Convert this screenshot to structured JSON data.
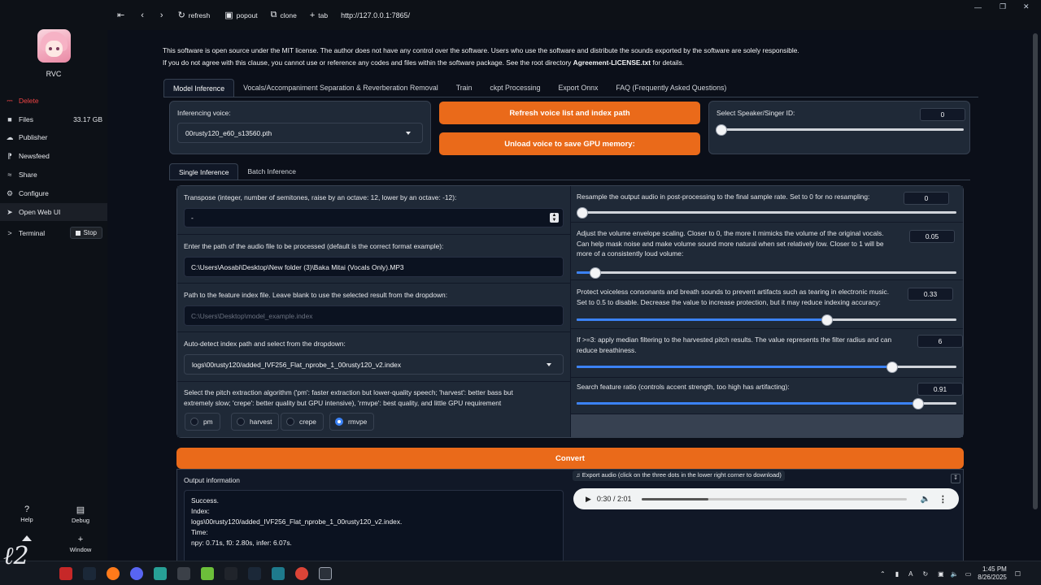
{
  "sidebar": {
    "app_name": "RVC",
    "items": [
      {
        "label": "Delete",
        "icon": "trash-icon"
      },
      {
        "label": "Files",
        "icon": "folder-icon",
        "value": "33.17 GB"
      },
      {
        "label": "Publisher",
        "icon": "publish-icon"
      },
      {
        "label": "Newsfeed",
        "icon": "rss-icon"
      },
      {
        "label": "Share",
        "icon": "wifi-icon"
      },
      {
        "label": "Configure",
        "icon": "gear-icon"
      },
      {
        "label": "Open Web UI",
        "icon": "rocket-icon"
      },
      {
        "label": "Terminal",
        "icon": "terminal-icon"
      }
    ],
    "stop_label": "Stop",
    "help_label": "Help",
    "debug_label": "Debug",
    "window_label": "Window"
  },
  "browser": {
    "refresh_label": "refresh",
    "popout_label": "popout",
    "clone_label": "clone",
    "tab_label": "tab",
    "url": "http://127.0.0.1:7865/"
  },
  "notice": {
    "line1": "This software is open source under the MIT license. The author does not have any control over the software. Users who use the software and distribute the sounds exported by the software are solely responsible.",
    "line2_pre": "If you do not agree with this clause, you cannot use or reference any codes and files within the software package. See the root directory ",
    "line2_bold": "Agreement-LICENSE.txt",
    "line2_post": " for details."
  },
  "tabs": [
    "Model Inference",
    "Vocals/Accompaniment Separation & Reverberation Removal",
    "Train",
    "ckpt Processing",
    "Export Onnx",
    "FAQ (Frequently Asked Questions)"
  ],
  "model": {
    "voice_label": "Inferencing voice:",
    "voice_value": "00rusty120_e60_s13560.pth",
    "refresh_btn": "Refresh voice list and index path",
    "unload_btn": "Unload voice to save GPU memory:",
    "speaker_label": "Select Speaker/Singer ID:",
    "speaker_value": "0",
    "speaker_level": 0
  },
  "subtabs": [
    "Single Inference",
    "Batch Inference"
  ],
  "left": {
    "transpose_label": "Transpose (integer, number of semitones, raise by an octave: 12, lower by an octave: -12):",
    "transpose_value": "-",
    "audio_path_label": "Enter the path of the audio file to be processed (default is the correct format example):",
    "audio_path_value": "C:\\Users\\Aosabi\\Desktop\\New folder (3)\\Baka Mitai (Vocals Only).MP3",
    "index_path_label": "Path to the feature index file. Leave blank to use the selected result from the dropdown:",
    "index_path_placeholder": "C:\\Users\\Desktop\\model_example.index",
    "auto_index_label": "Auto-detect index path and select from the dropdown:",
    "auto_index_value": "logs\\00rusty120/added_IVF256_Flat_nprobe_1_00rusty120_v2.index",
    "pitch_label_1": "Select the pitch extraction algorithm ('pm': faster extraction but lower-quality speech; 'harvest': better bass but",
    "pitch_label_2": "extremely slow; 'crepe': better quality but GPU intensive), 'rmvpe': best quality, and little GPU requirement",
    "pitch_options": [
      "pm",
      "harvest",
      "crepe",
      "rmvpe"
    ],
    "pitch_selected": "rmvpe"
  },
  "right": {
    "resample_label": "Resample the output audio in post-processing to the final sample rate. Set to 0 for no resampling:",
    "resample_value": "0",
    "resample_level": 0,
    "volume_label_1": "Adjust the volume envelope scaling. Closer to 0, the more it mimicks the volume of the original vocals.",
    "volume_label_2": "Can help mask noise and make volume sound more natural when set relatively low. Closer to 1 will be",
    "volume_label_3": "more of a consistently loud volume:",
    "volume_value": "0.05",
    "volume_level": 0.05,
    "protect_label_1": "Protect voiceless consonants and breath sounds to prevent artifacts such as tearing in electronic music.",
    "protect_label_2": "Set to 0.5 to disable. Decrease the value to increase protection, but it may reduce indexing accuracy:",
    "protect_value": "0.33",
    "protect_level": 0.66,
    "median_label_1": "If >=3: apply median filtering to the harvested pitch results. The value represents the filter radius and can",
    "median_label_2": "reduce breathiness.",
    "median_value": "6",
    "median_level": 0.83,
    "ratio_label": "Search feature ratio (controls accent strength, too high has artifacting):",
    "ratio_value": "0.91",
    "ratio_level": 0.9
  },
  "convert_label": "Convert",
  "output": {
    "label": "Output information",
    "lines": [
      "Success.",
      "Index:",
      "logs\\00rusty120/added_IVF256_Flat_nprobe_1_00rusty120_v2.index.",
      "Time:",
      "npy: 0.71s, f0: 2.80s, infer: 6.07s."
    ],
    "export_label": "Export audio (click on the three dots in the lower right corner to download)",
    "audio_time": "0:30 / 2:01",
    "audio_progress": 0.25
  },
  "taskbar": {
    "time": "1:45 PM",
    "date": "8/26/2025"
  },
  "colors": {
    "accent": "#ea6a1a",
    "slider": "#3b82f6",
    "background": "#0b0f19"
  }
}
